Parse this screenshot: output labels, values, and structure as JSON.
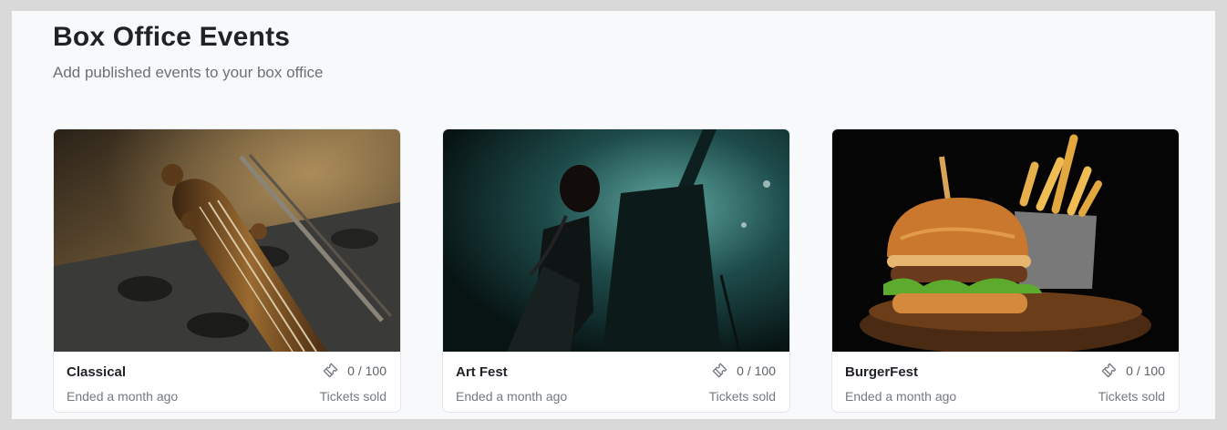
{
  "header": {
    "title": "Box Office Events",
    "subtitle": "Add published events to your box office"
  },
  "events": [
    {
      "name": "Classical",
      "status": "Ended a month ago",
      "tickets": "0 / 100",
      "tickets_label": "Tickets sold",
      "icon": "ticket-icon"
    },
    {
      "name": "Art Fest",
      "status": "Ended a month ago",
      "tickets": "0 / 100",
      "tickets_label": "Tickets sold",
      "icon": "ticket-icon"
    },
    {
      "name": "BurgerFest",
      "status": "Ended a month ago",
      "tickets": "0 / 100",
      "tickets_label": "Tickets sold",
      "icon": "ticket-icon"
    }
  ],
  "colors": {
    "background": "#d9d9d9",
    "panel": "#f8f9fa",
    "text_primary": "#1f2328",
    "text_muted": "#747a81"
  }
}
